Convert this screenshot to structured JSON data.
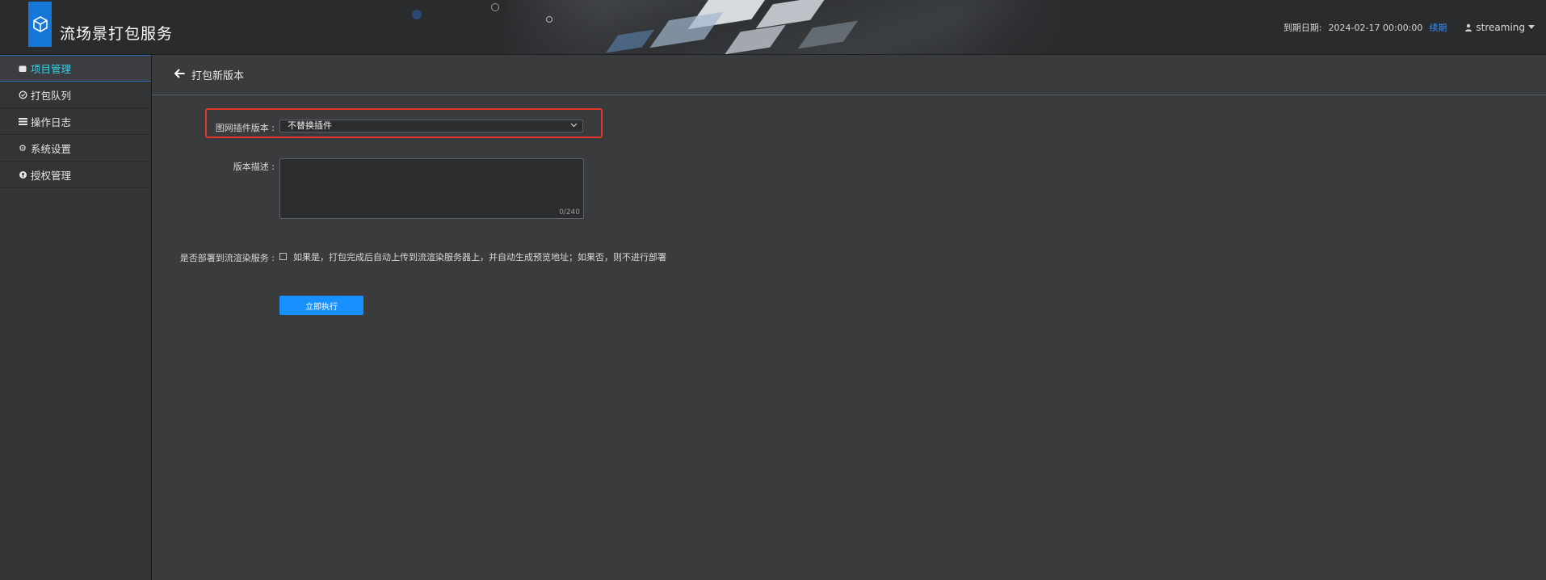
{
  "header": {
    "app_title": "流场景打包服务",
    "expiry_label": "到期日期:",
    "expiry_value": "2024-02-17 00:00:00",
    "renew_link": "续期",
    "username": "streaming",
    "logo_icon": "cube-logo-icon",
    "accent_color": "#1677d8"
  },
  "sidebar": {
    "items": [
      {
        "label": "项目管理",
        "icon": "folder-icon",
        "active": true
      },
      {
        "label": "打包队列",
        "icon": "queue-icon",
        "active": false
      },
      {
        "label": "操作日志",
        "icon": "log-icon",
        "active": false
      },
      {
        "label": "系统设置",
        "icon": "gear-icon",
        "active": false
      },
      {
        "label": "授权管理",
        "icon": "key-icon",
        "active": false
      }
    ]
  },
  "main": {
    "page_title": "打包新版本",
    "form": {
      "plugin_label": "图网插件版本 :",
      "plugin_value": "不替换插件",
      "desc_label": "版本描述 :",
      "desc_counter": "0/240",
      "deploy_label": "是否部署到流渲染服务 :",
      "deploy_desc": "如果是，打包完成后自动上传到流渲染服务器上，并自动生成预览地址；如果否，则不进行部署",
      "submit_label": "立即执行"
    }
  },
  "colors": {
    "active_nav": "#35d0e6",
    "primary_button": "#1890ff",
    "highlight": "#e0362c",
    "link": "#3d8ef0"
  }
}
